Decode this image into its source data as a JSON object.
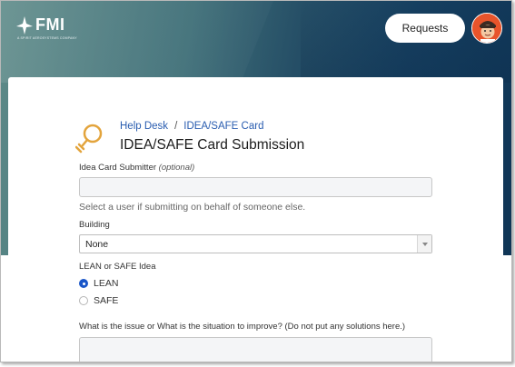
{
  "header": {
    "logo_text": "FMI",
    "logo_subtext": "A SPIRIT AEROSYSTEMS COMPANY",
    "requests_label": "Requests"
  },
  "breadcrumb": {
    "home": "Help Desk",
    "separator": "/",
    "current": "IDEA/SAFE Card"
  },
  "page": {
    "title": "IDEA/SAFE Card Submission"
  },
  "form": {
    "submitter": {
      "label": "Idea Card Submitter",
      "optional": "(optional)",
      "value": "",
      "help": "Select a user if submitting on behalf of someone else."
    },
    "building": {
      "label": "Building",
      "selected": "None"
    },
    "idea_type": {
      "label": "LEAN or SAFE Idea",
      "options": [
        "LEAN",
        "SAFE"
      ],
      "selected": "LEAN"
    },
    "issue": {
      "label": "What is the issue or What is the situation to improve? (Do not put any solutions here.)",
      "value": ""
    }
  },
  "colors": {
    "link": "#2a5db0",
    "radio_selected": "#1a56c8",
    "avatar_bg": "#e8542b",
    "bulb": "#e3a43c"
  }
}
